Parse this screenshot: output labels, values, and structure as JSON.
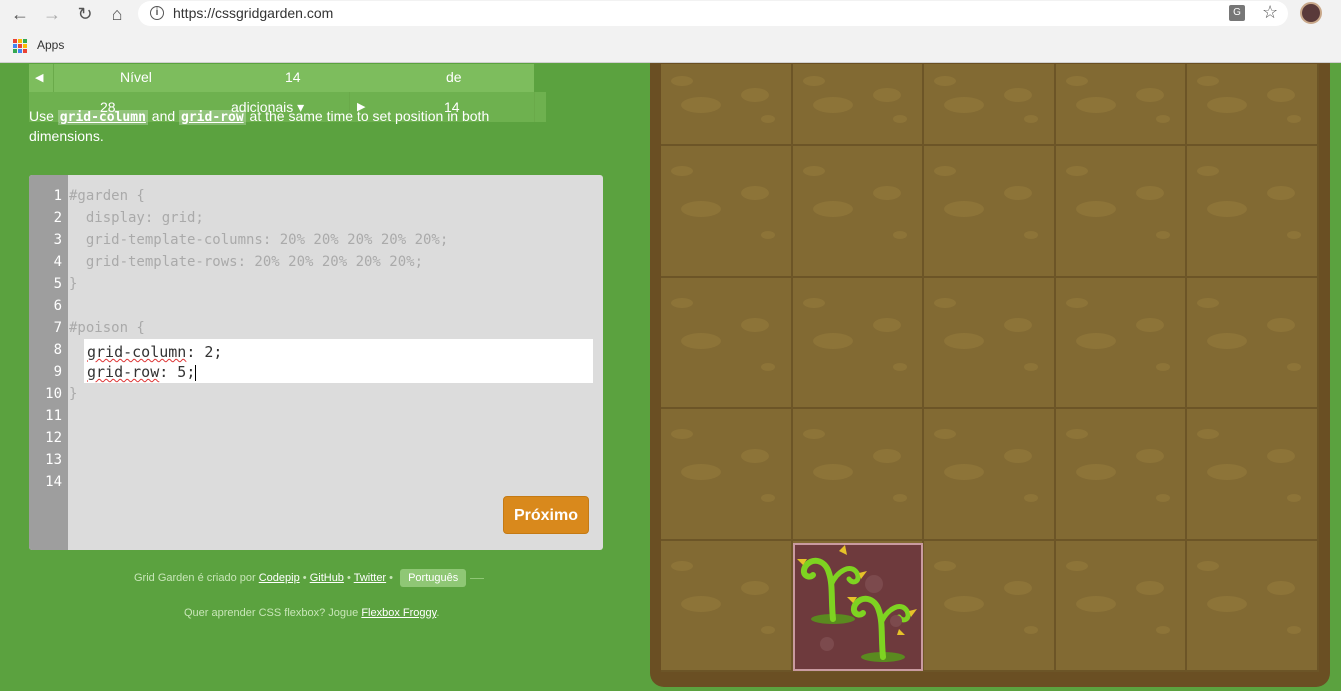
{
  "browser": {
    "url": "https://cssgridgarden.com",
    "bookmarks_label": "Apps"
  },
  "level": {
    "label": "Nível",
    "current": "14",
    "of_label": "de",
    "total": "28",
    "extra_label": "adicionais ▾",
    "extra_count": "14"
  },
  "instructions": {
    "before": "Use ",
    "code1": "grid-column",
    "middle": " and ",
    "code2": "grid-row",
    "after": " at the same time to set position in both dimensions."
  },
  "editor": {
    "line_numbers": [
      "1",
      "2",
      "3",
      "4",
      "5",
      "6",
      "7",
      "8",
      "9",
      "10",
      "11",
      "12",
      "13",
      "14"
    ],
    "lines": [
      "#garden {",
      "  display: grid;",
      "  grid-template-columns: 20% 20% 20% 20% 20%;",
      "  grid-template-rows: 20% 20% 20% 20% 20%;",
      "}",
      "",
      "#poison {",
      "",
      "",
      "}"
    ],
    "input_line1_prop": "grid-column",
    "input_line1_val": ": 2;",
    "input_line2_prop": "grid-row",
    "input_line2_val": ": 5;",
    "next_label": "Próximo"
  },
  "footer": {
    "created_by": "Grid Garden é criado por ",
    "codepip": "Codepip",
    "sep": " • ",
    "github": "GitHub",
    "twitter": "Twitter",
    "language": "Português",
    "flexbox_prompt": "Quer aprender CSS flexbox? Jogue ",
    "flexbox_link": "Flexbox Froggy",
    "flexbox_end": "."
  },
  "colors": {
    "background": "#5ba23f",
    "soil": "#826a33",
    "poison": "#6e3a3d",
    "next_button": "#d9891c"
  }
}
